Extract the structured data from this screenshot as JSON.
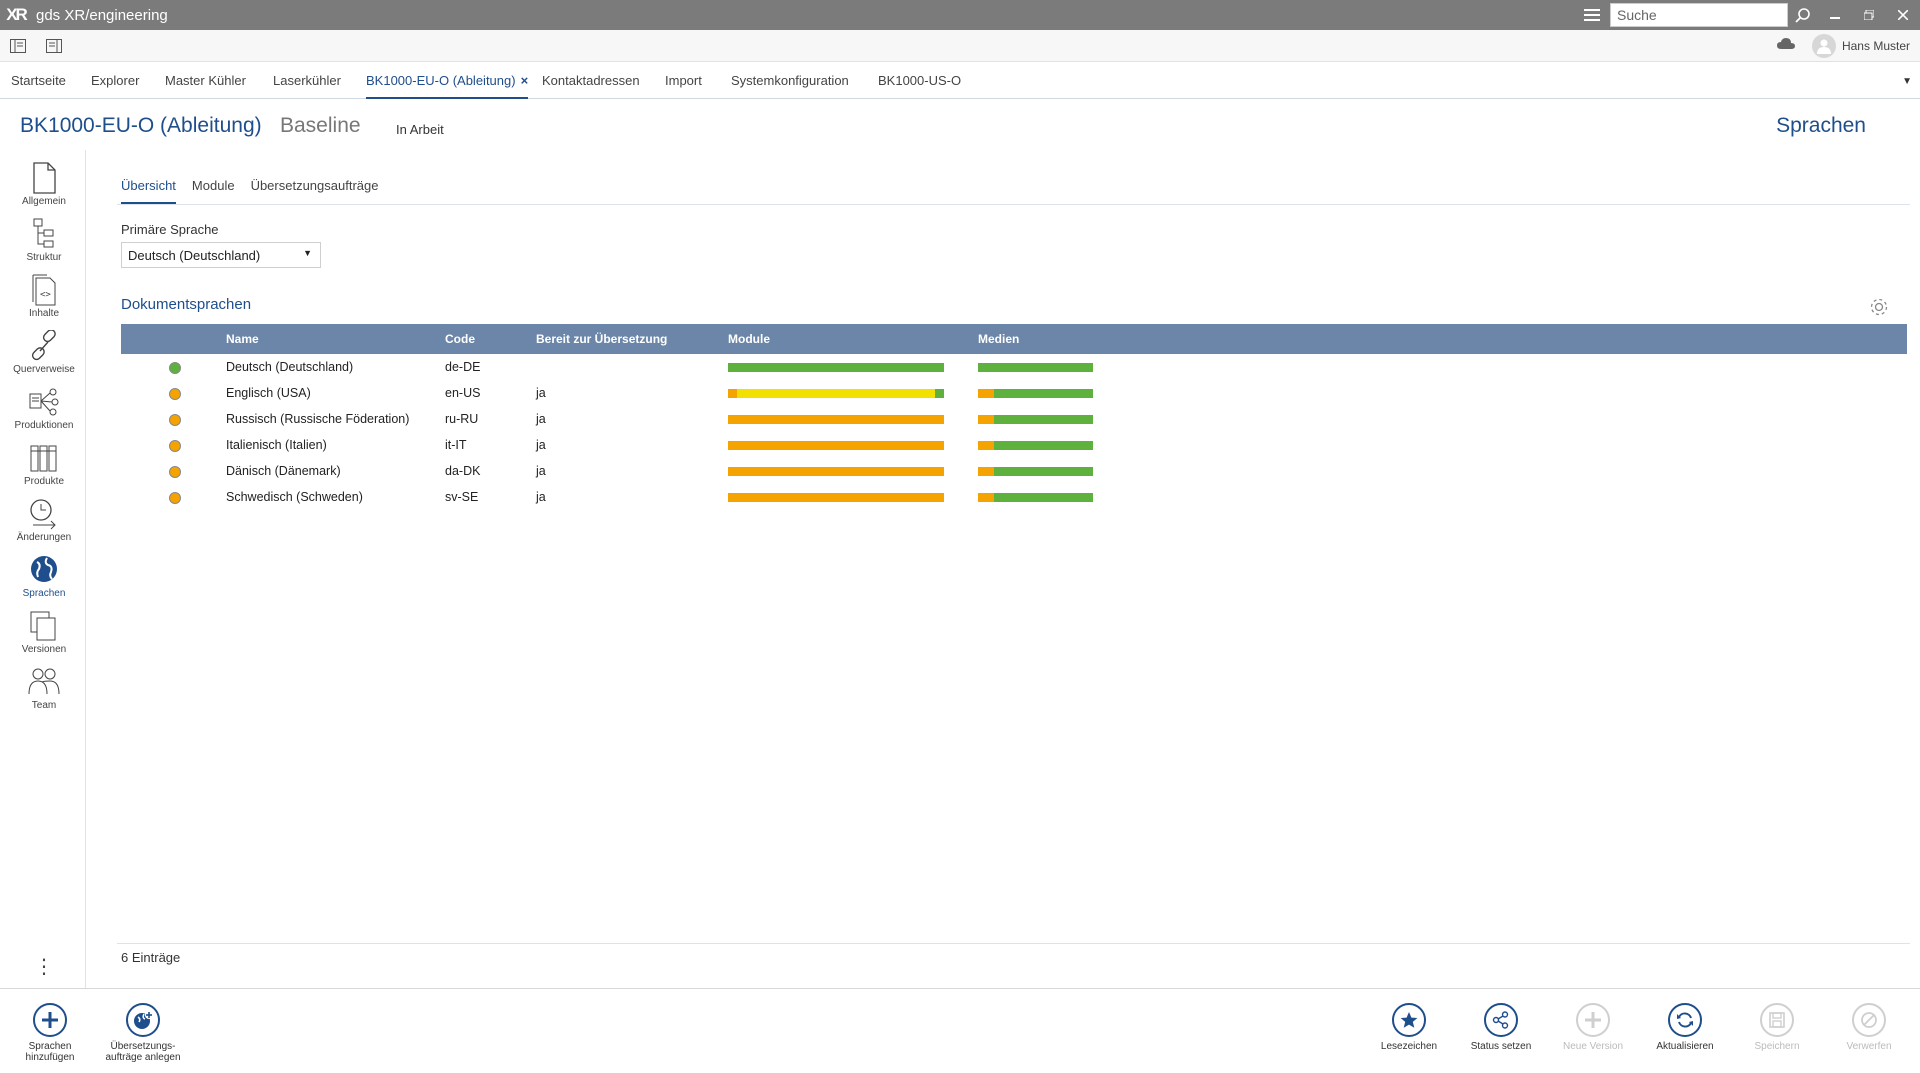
{
  "app": {
    "title": "gds XR/engineering",
    "logo": "XR"
  },
  "search": {
    "placeholder": "Suche"
  },
  "user": {
    "name": "Hans Muster"
  },
  "tabs": [
    {
      "label": "Startseite"
    },
    {
      "label": "Explorer"
    },
    {
      "label": "Master Kühler"
    },
    {
      "label": "Laserkühler"
    },
    {
      "label": "BK1000-EU-O (Ableitung)",
      "active": true,
      "close": "×"
    },
    {
      "label": "Kontaktadressen"
    },
    {
      "label": "Import"
    },
    {
      "label": "Systemkonfiguration"
    },
    {
      "label": "BK1000-US-O"
    }
  ],
  "header": {
    "doc": "BK1000-EU-O (Ableitung)",
    "baseline": "Baseline",
    "state": "In Arbeit",
    "section": "Sprachen"
  },
  "nav": [
    {
      "label": "Allgemein",
      "icon": "document-icon"
    },
    {
      "label": "Struktur",
      "icon": "structure-icon"
    },
    {
      "label": "Inhalte",
      "icon": "content-icon"
    },
    {
      "label": "Querverweise",
      "icon": "link-icon"
    },
    {
      "label": "Produktionen",
      "icon": "production-icon"
    },
    {
      "label": "Produkte",
      "icon": "products-icon"
    },
    {
      "label": "Änderungen",
      "icon": "changes-icon"
    },
    {
      "label": "Sprachen",
      "icon": "globe-icon",
      "active": true
    },
    {
      "label": "Versionen",
      "icon": "versions-icon"
    },
    {
      "label": "Team",
      "icon": "team-icon"
    }
  ],
  "subtabs": [
    {
      "label": "Übersicht",
      "active": true
    },
    {
      "label": "Module"
    },
    {
      "label": "Übersetzungsaufträge"
    }
  ],
  "primary": {
    "label": "Primäre Sprache",
    "value": "Deutsch (Deutschland)"
  },
  "doclangs": {
    "title": "Dokumentsprachen",
    "columns": {
      "name": "Name",
      "code": "Code",
      "ready": "Bereit zur Übersetzung",
      "modules": "Module",
      "media": "Medien"
    },
    "rows": [
      {
        "status": "green",
        "name": "Deutsch (Deutschland)",
        "code": "de-DE",
        "ready": "",
        "modules": [
          [
            "#5fb13d",
            1.0
          ]
        ],
        "media": [
          [
            "#5fb13d",
            1.0
          ]
        ]
      },
      {
        "status": "orange",
        "name": "Englisch (USA)",
        "code": "en-US",
        "ready": "ja",
        "modules": [
          [
            "#f5a300",
            0.04
          ],
          [
            "#f2e000",
            0.92
          ],
          [
            "#5fb13d",
            0.04
          ]
        ],
        "media": [
          [
            "#f5a300",
            0.14
          ],
          [
            "#5fb13d",
            0.86
          ]
        ]
      },
      {
        "status": "orange",
        "name": "Russisch (Russische Föderation)",
        "code": "ru-RU",
        "ready": "ja",
        "modules": [
          [
            "#f5a300",
            1.0
          ]
        ],
        "media": [
          [
            "#f5a300",
            0.14
          ],
          [
            "#5fb13d",
            0.86
          ]
        ]
      },
      {
        "status": "orange",
        "name": "Italienisch (Italien)",
        "code": "it-IT",
        "ready": "ja",
        "modules": [
          [
            "#f5a300",
            1.0
          ]
        ],
        "media": [
          [
            "#f5a300",
            0.14
          ],
          [
            "#5fb13d",
            0.86
          ]
        ]
      },
      {
        "status": "orange",
        "name": "Dänisch (Dänemark)",
        "code": "da-DK",
        "ready": "ja",
        "modules": [
          [
            "#f5a300",
            1.0
          ]
        ],
        "media": [
          [
            "#f5a300",
            0.14
          ],
          [
            "#5fb13d",
            0.86
          ]
        ]
      },
      {
        "status": "orange",
        "name": "Schwedisch (Schweden)",
        "code": "sv-SE",
        "ready": "ja",
        "modules": [
          [
            "#f5a300",
            1.0
          ]
        ],
        "media": [
          [
            "#f5a300",
            0.14
          ],
          [
            "#5fb13d",
            0.86
          ]
        ]
      }
    ],
    "count": "6 Einträge"
  },
  "actions_left": [
    {
      "label1": "Sprachen",
      "label2": "hinzufügen",
      "icon": "add-icon"
    },
    {
      "label1": "Übersetzungs-",
      "label2": "aufträge anlegen",
      "icon": "globe-add-icon"
    }
  ],
  "actions_right": [
    {
      "label": "Lesezeichen",
      "icon": "star-icon",
      "disabled": false
    },
    {
      "label": "Status setzen",
      "icon": "share-icon",
      "disabled": false
    },
    {
      "label": "Neue Version",
      "icon": "add-icon",
      "disabled": true
    },
    {
      "label": "Aktualisieren",
      "icon": "refresh-icon",
      "disabled": false
    },
    {
      "label": "Speichern",
      "icon": "save-icon",
      "disabled": true
    },
    {
      "label": "Verwerfen",
      "icon": "discard-icon",
      "disabled": true
    }
  ],
  "colors": {
    "accent": "#1f4e8c",
    "header": "#6b86a8",
    "green": "#5fb13d",
    "orange": "#f5a300",
    "yellow": "#f2e000"
  }
}
